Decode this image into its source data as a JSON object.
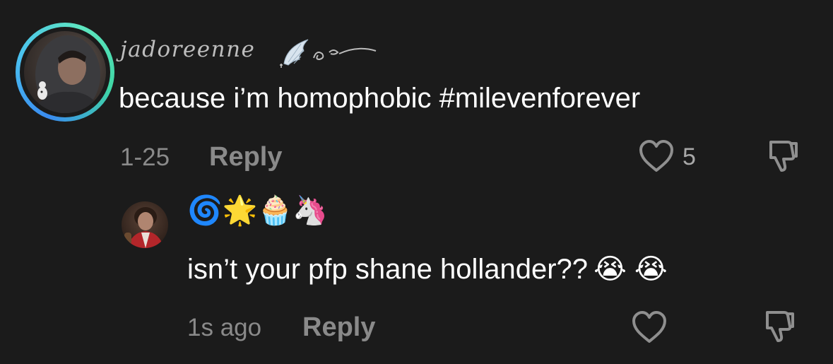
{
  "comment": {
    "username": "jadoreenne",
    "text": "because i’m homophobic #milevenforever",
    "date": "1-25",
    "reply_label": "Reply",
    "like_count": "5",
    "ring_colors": [
      "#3a8bf0",
      "#4ac2f0",
      "#5ee6c0",
      "#3fd6a5"
    ],
    "icons": [
      "avatar",
      "wing-decoration",
      "heart-icon",
      "dislike-icon"
    ]
  },
  "reply": {
    "display_name": "🌀🌟🧁🦄",
    "text": "isn’t your pfp shane hollander??",
    "text_emojis": "😭 😭",
    "time": "1s ago",
    "reply_label": "Reply",
    "icons": [
      "avatar",
      "heart-icon",
      "dislike-icon"
    ]
  },
  "colors": {
    "background": "#1b1b1b",
    "primary_text": "#ffffff",
    "secondary_text": "#8a8a8a"
  }
}
